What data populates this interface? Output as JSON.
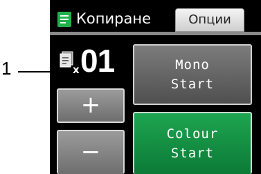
{
  "callout": {
    "number": "1"
  },
  "header": {
    "mode_title": "Копиране",
    "options_label": "Опции"
  },
  "copies": {
    "multiplier": "x",
    "count": "01"
  },
  "buttons": {
    "plus": "+",
    "minus": "−",
    "mono_line1": "Mono",
    "mono_line2": "Start",
    "colour_line1": "Colour",
    "colour_line2": "Start"
  },
  "icons": {
    "mode": "copy-document-icon",
    "copies": "document-stack-icon"
  },
  "colors": {
    "screen_bg": "#000000",
    "mono_button": "#636363",
    "colour_button": "#149245",
    "icon_green": "#22b04b"
  }
}
